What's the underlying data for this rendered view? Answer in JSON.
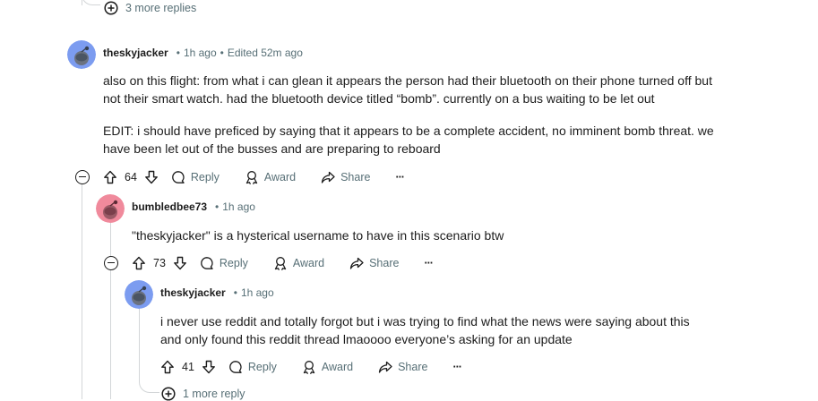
{
  "top_more": {
    "label": "3 more replies"
  },
  "comments": [
    {
      "username": "theskyjacker",
      "time": "1h ago",
      "edited": "Edited 52m ago",
      "paragraphs": [
        "also on this flight: from what i can glean it appears the person had their bluetooth on their phone turned off but not their smart watch. had the bluetooth device titled “bomb”. currently on a bus waiting to be let out",
        "EDIT: i should have preficed by saying that it appears to be a complete accident, no imminent bomb threat. we have been let out of the busses and are preparing to reboard"
      ],
      "score": "64",
      "avatar_color": "#7c9cf0"
    },
    {
      "username": "bumbledbee73",
      "time": "1h ago",
      "paragraphs": [
        "\"theskyjacker\" is a hysterical username to have in this scenario btw"
      ],
      "score": "73",
      "avatar_color": "#f08a9c"
    },
    {
      "username": "theskyjacker",
      "time": "1h ago",
      "paragraphs": [
        "i never use reddit and totally forgot but i was trying to find what the news were saying about this and only found this reddit thread lmaoooo everyone’s asking for an update"
      ],
      "score": "41",
      "avatar_color": "#7c9cf0"
    }
  ],
  "actions": {
    "reply": "Reply",
    "award": "Award",
    "share": "Share",
    "more": "···"
  },
  "bottom_more": {
    "label": "1 more reply"
  },
  "icons": {
    "add": "plus-circle-icon",
    "collapse": "minus-circle-icon",
    "upvote": "upvote-arrow-icon",
    "downvote": "downvote-arrow-icon",
    "reply": "speech-bubble-icon",
    "award": "award-ribbon-icon",
    "share": "share-arrow-icon",
    "more": "ellipsis-icon"
  }
}
